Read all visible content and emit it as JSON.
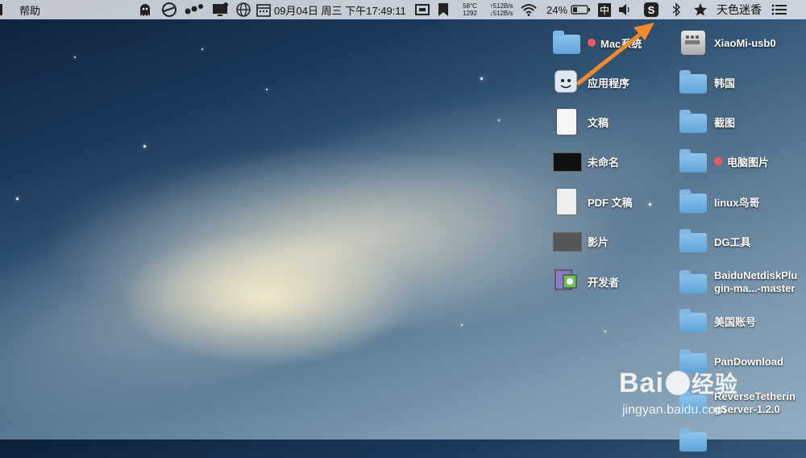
{
  "menubar": {
    "left_menu": "帮助",
    "date_time": "09月04日 周三 下午17:49:11",
    "cpu_temp": "58°C",
    "fan_speed": "1292",
    "net_up": "↑512B/s",
    "net_down": "↓512B/s",
    "battery": "24%",
    "input_method": "中",
    "user": "天色迷香"
  },
  "desktop": {
    "left_column": [
      {
        "label": "Mac系统",
        "type": "folder",
        "tag": true
      },
      {
        "label": "应用程序",
        "type": "app"
      },
      {
        "label": "文稿",
        "type": "doc"
      },
      {
        "label": "未命名",
        "type": "image"
      },
      {
        "label": "PDF 文稿",
        "type": "doc"
      },
      {
        "label": "影片",
        "type": "image"
      },
      {
        "label": "开发者",
        "type": "app"
      }
    ],
    "right_column": [
      {
        "label": "XiaoMi-usb0",
        "type": "drive"
      },
      {
        "label": "韩国",
        "type": "folder"
      },
      {
        "label": "截图",
        "type": "folder"
      },
      {
        "label": "电脑图片",
        "type": "folder",
        "tag": true
      },
      {
        "label": "linux鸟哥",
        "type": "folder"
      },
      {
        "label": "DG工具",
        "type": "folder"
      },
      {
        "label_line1": "BaiduNetdiskPlu",
        "label_line2": "gin-ma...-master",
        "type": "folder"
      },
      {
        "label": "美国账号",
        "type": "folder"
      },
      {
        "label": "PanDownload",
        "type": "folder"
      },
      {
        "label_line1": "ReverseTetherin",
        "label_line2": "gServer-1.2.0",
        "type": "folder"
      }
    ]
  },
  "watermark": {
    "brand": "Bai",
    "brand2": "经验",
    "url": "jingyan.baidu.com"
  },
  "colors": {
    "arrow": "#f28a2e",
    "tag_red": "#f2575c",
    "folder_blue": "#6aaee0"
  }
}
